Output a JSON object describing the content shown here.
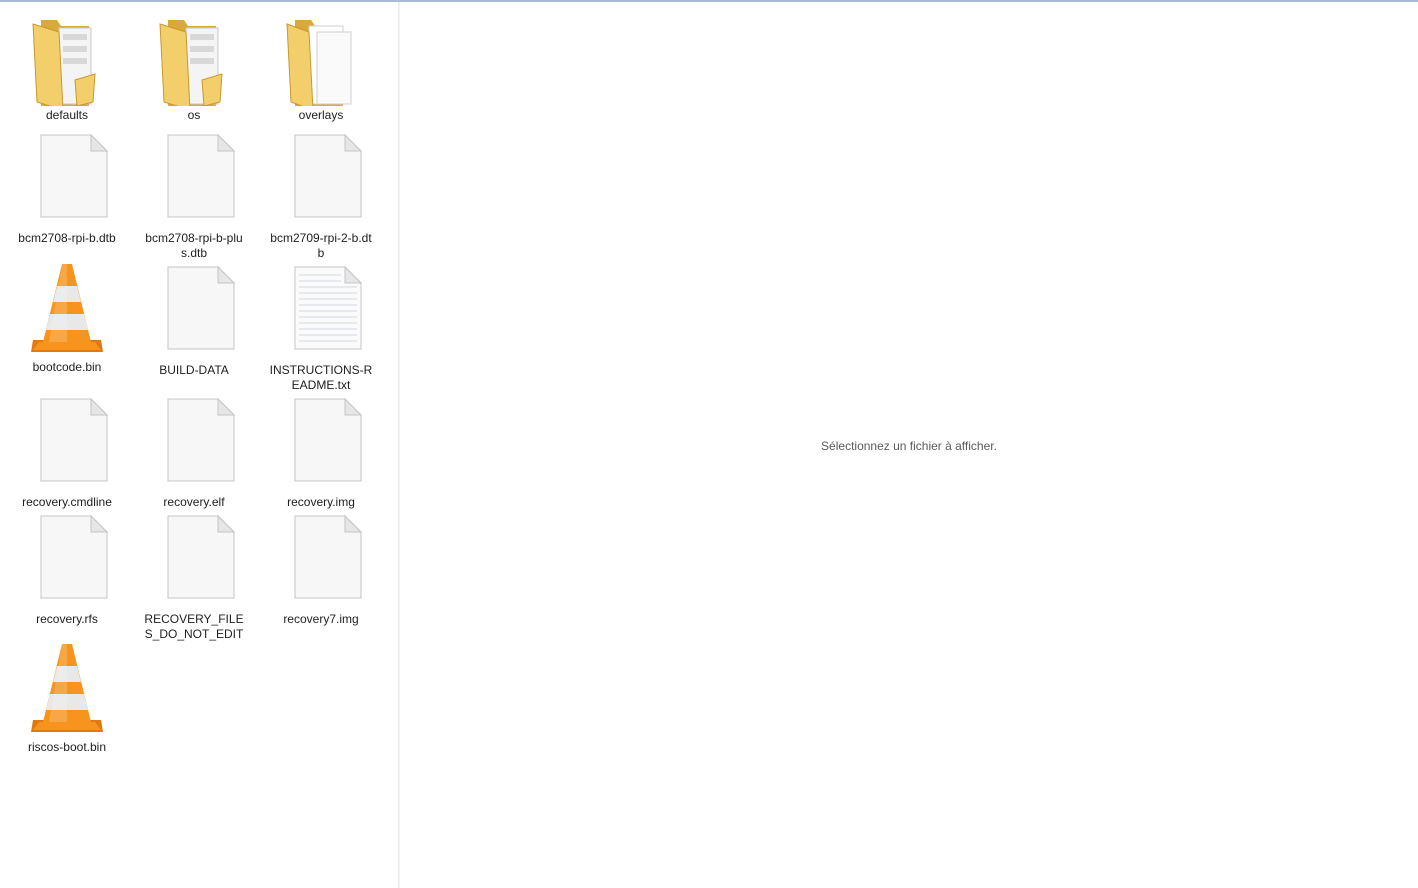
{
  "preview": {
    "message": "Sélectionnez un fichier à afficher."
  },
  "items": [
    {
      "label": "defaults",
      "icon": "folder-icon"
    },
    {
      "label": "os",
      "icon": "folder-icon"
    },
    {
      "label": "overlays",
      "icon": "folder-open-icon"
    },
    {
      "label": "bcm2708-rpi-b.dtb",
      "icon": "file-icon"
    },
    {
      "label": "bcm2708-rpi-b-plus.dtb",
      "icon": "file-icon"
    },
    {
      "label": "bcm2709-rpi-2-b.dtb",
      "icon": "file-icon"
    },
    {
      "label": "bootcode.bin",
      "icon": "vlc-cone-icon"
    },
    {
      "label": "BUILD-DATA",
      "icon": "file-icon"
    },
    {
      "label": "INSTRUCTIONS-README.txt",
      "icon": "text-file-icon"
    },
    {
      "label": "recovery.cmdline",
      "icon": "file-icon"
    },
    {
      "label": "recovery.elf",
      "icon": "file-icon"
    },
    {
      "label": "recovery.img",
      "icon": "file-icon"
    },
    {
      "label": "recovery.rfs",
      "icon": "file-icon"
    },
    {
      "label": "RECOVERY_FILES_DO_NOT_EDIT",
      "icon": "file-icon"
    },
    {
      "label": "recovery7.img",
      "icon": "file-icon"
    },
    {
      "label": "riscos-boot.bin",
      "icon": "vlc-cone-icon"
    }
  ],
  "colors": {
    "folder": "#f2cf6b",
    "folder_dark": "#d9a93a",
    "cone_orange": "#f7941d",
    "cone_stripe": "#e8e8e8",
    "text": "#1e1e1e",
    "preview_text": "#5a5a5a"
  }
}
